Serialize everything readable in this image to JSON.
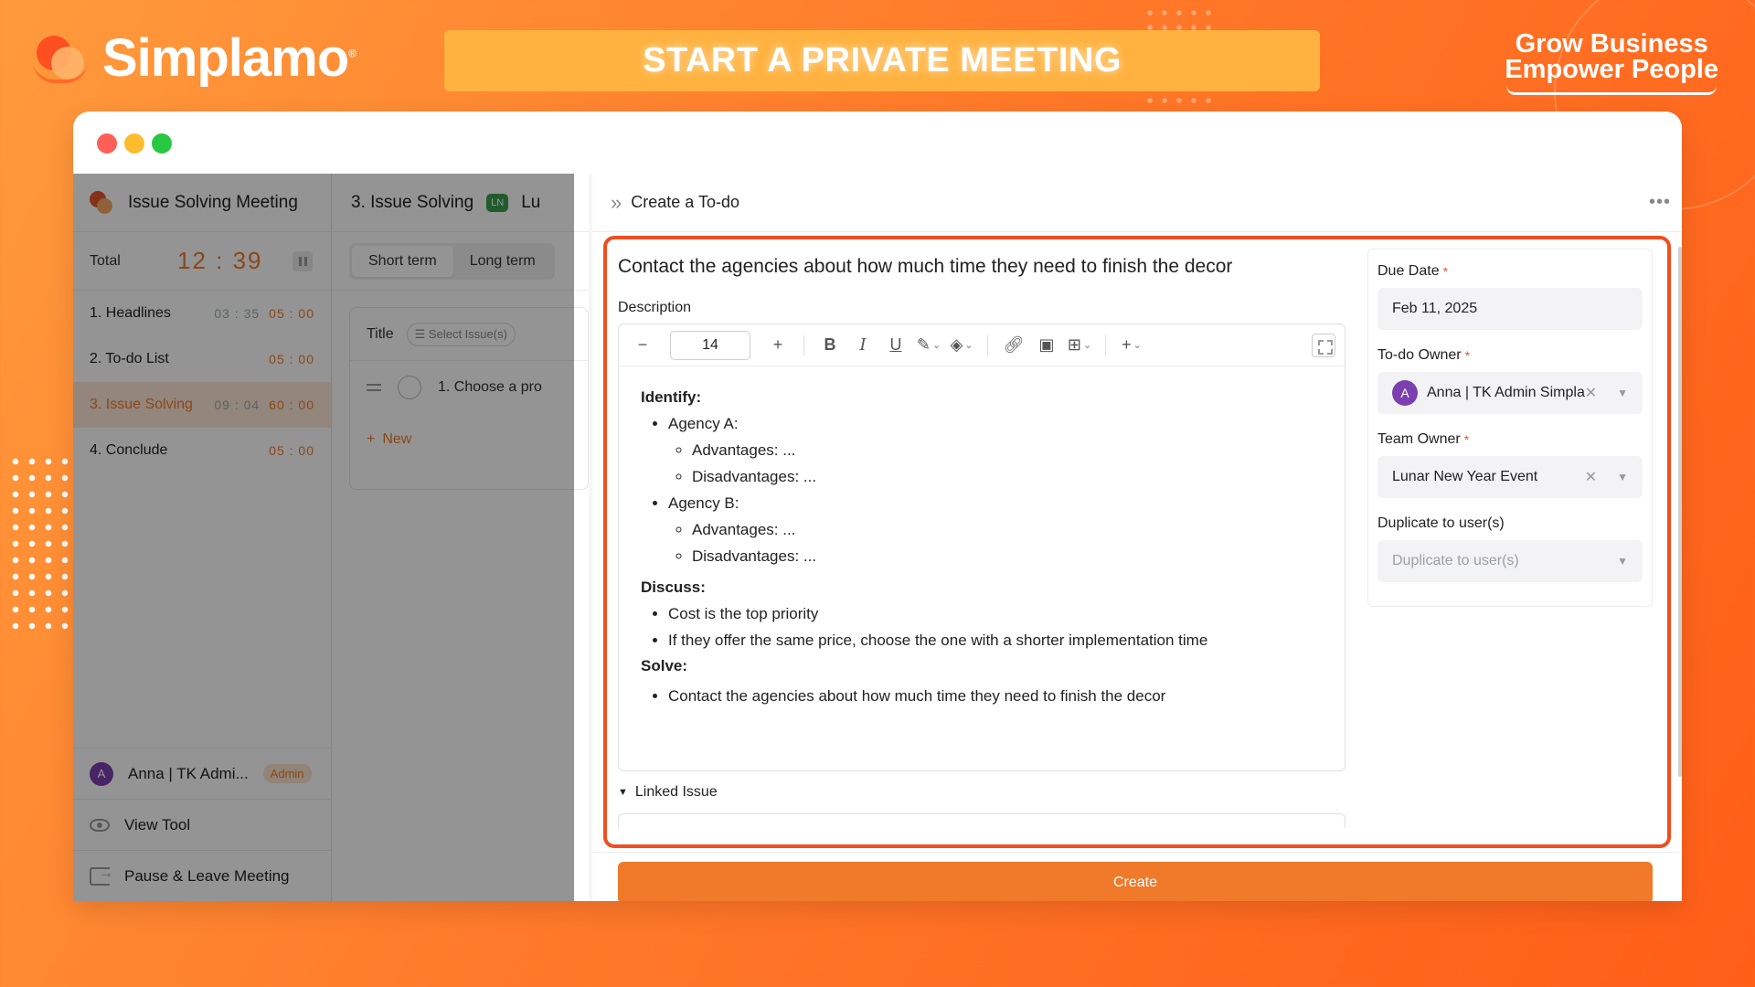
{
  "brand": {
    "name": "Simplamo",
    "registered": "®"
  },
  "banner": {
    "text": "START A PRIVATE MEETING"
  },
  "tagline": {
    "line1": "Grow Business",
    "line2": "Empower People"
  },
  "sidebar": {
    "meeting_title": "Issue Solving Meeting",
    "timer": {
      "label": "Total",
      "value": "12 : 39"
    },
    "agenda": [
      {
        "name": "1.  Headlines",
        "elapsed": "03 : 35",
        "duration": "05 : 00"
      },
      {
        "name": "2.  To-do List",
        "elapsed": "",
        "duration": "05 : 00"
      },
      {
        "name": "3.  Issue Solving",
        "elapsed": "09 : 04",
        "duration": "60 : 00"
      },
      {
        "name": "4.  Conclude",
        "elapsed": "",
        "duration": "05 : 00"
      }
    ],
    "user": {
      "initial": "A",
      "name": "Anna | TK Admi...",
      "role": "Admin"
    },
    "view_tool": "View Tool",
    "pause_leave": "Pause & Leave Meeting"
  },
  "middle": {
    "header": "3. Issue Solving",
    "badge": "LN",
    "header_tail": "Lu",
    "tabs": [
      "Short term",
      "Long term"
    ],
    "table": {
      "title_col": "Title",
      "select_issues": "Select Issue(s)"
    },
    "issue_row": "1. Choose a pro",
    "new_label": "New"
  },
  "drawer": {
    "title": "Create a To-do",
    "todo_title": "Contact the agencies about how much time  they need to finish the decor",
    "description_label": "Description",
    "font_size": "14",
    "content": {
      "identify": "Identify:",
      "agency_a": "Agency A:",
      "agency_b": "Agency B:",
      "advantages": "Advantages: ...",
      "disadvantages": "Disadvantages: ...",
      "discuss": "Discuss:",
      "discuss_1": "Cost is the top priority",
      "discuss_2": "If they offer the same price, choose the one with a shorter implementation time",
      "solve": "Solve:",
      "solve_1": "Contact the agencies about how much time  they need to finish the decor"
    },
    "linked_issue": "Linked Issue",
    "fields": {
      "due_date": {
        "label": "Due Date",
        "value": "Feb 11, 2025"
      },
      "todo_owner": {
        "label": "To-do Owner",
        "initial": "A",
        "value": "Anna | TK Admin Simpla"
      },
      "team_owner": {
        "label": "Team Owner",
        "value": "Lunar New Year Event"
      },
      "duplicate": {
        "label": "Duplicate to user(s)",
        "placeholder": "Duplicate to user(s)"
      }
    },
    "create_button": "Create"
  },
  "colors": {
    "accent": "#f07a2a",
    "highlight_border": "#f04e1f",
    "banner": "#ffb23f"
  }
}
